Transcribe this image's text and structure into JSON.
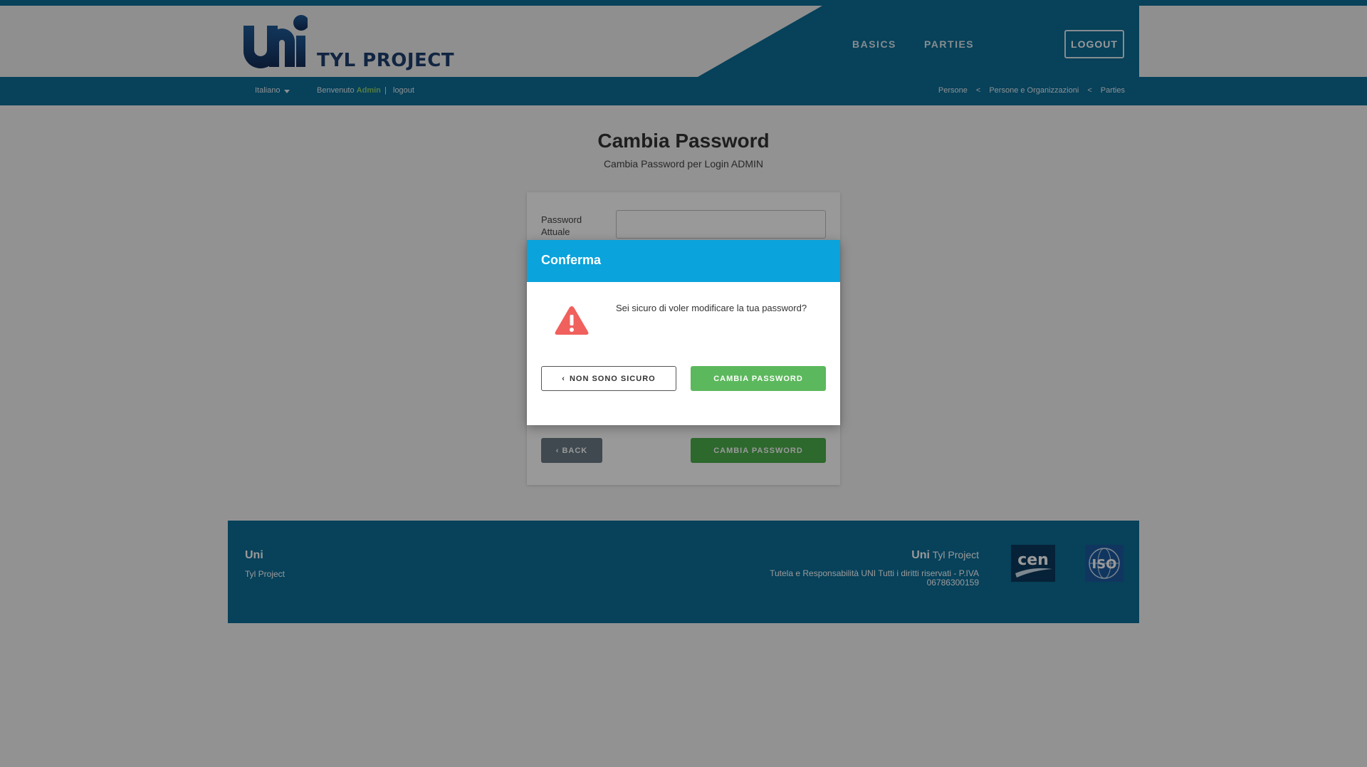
{
  "header": {
    "logo_text": "Uni",
    "brand": "TYL PROJECT",
    "nav": [
      {
        "label": "BASICS"
      },
      {
        "label": "PARTIES"
      }
    ],
    "logout_label": "LOGOUT"
  },
  "subbar": {
    "language": "Italiano",
    "welcome": "Benvenuto",
    "user": "Admin",
    "separator": "|",
    "logout_link": "logout",
    "breadcrumbs": [
      "Persone",
      "<",
      "Persone e Organizzazioni",
      "<",
      "Parties"
    ]
  },
  "page": {
    "title": "Cambia Password",
    "subtitle": "Cambia Password per Login ADMIN"
  },
  "form": {
    "current_password_label": "Password Attuale",
    "current_password_value": "",
    "back_label": "BACK",
    "submit_label": "CAMBIA PASSWORD"
  },
  "footer": {
    "brand": "Uni",
    "sub": "Tyl Project",
    "right_brand": "Uni",
    "right_sub": "Tyl Project",
    "copyright": "Tutela e Responsabilità UNI Tutti i diritti riservati - P.IVA 06786300159",
    "logos": [
      "cen-logo",
      "iso-logo"
    ]
  },
  "modal": {
    "title": "Conferma",
    "message": "Sei sicuro di voler modificare la tua password?",
    "cancel_label": "NON SONO SICURO",
    "confirm_label": "CAMBIA PASSWORD",
    "icon": "warning-icon"
  },
  "colors": {
    "primary_blue": "#0d6d97",
    "modal_header": "#0aa3dc",
    "success": "#5cb85c",
    "warning": "#f0605d"
  }
}
